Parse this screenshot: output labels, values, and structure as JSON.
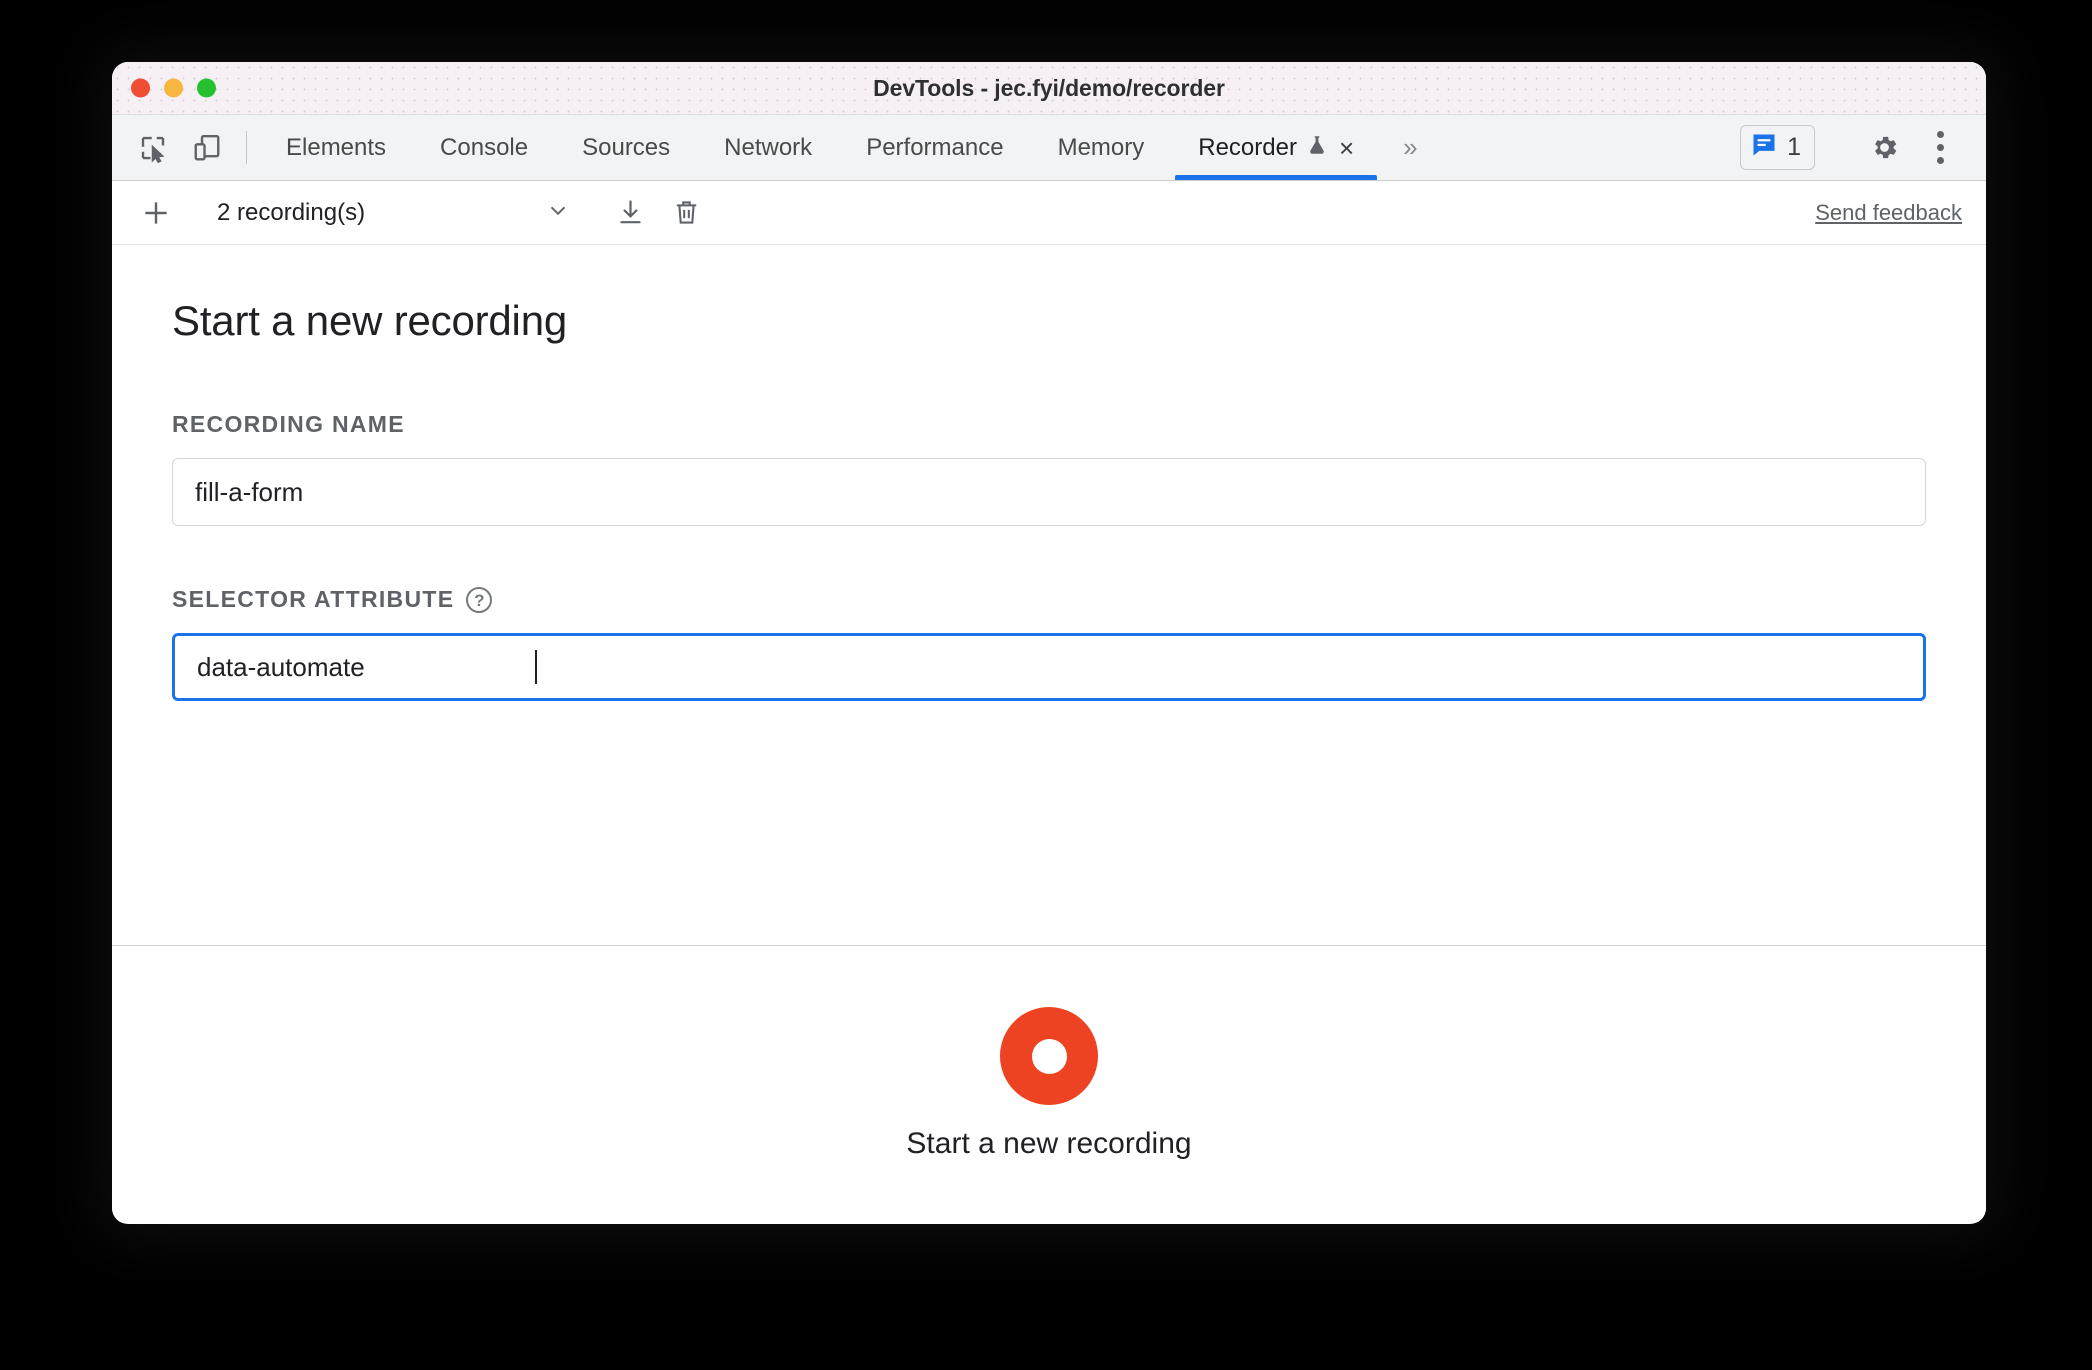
{
  "window": {
    "title": "DevTools - jec.fyi/demo/recorder",
    "traffic_lights": [
      "close",
      "minimize",
      "maximize"
    ]
  },
  "tabbar": {
    "left_icons": [
      {
        "name": "inspect-element-icon",
        "label": "Inspect element"
      },
      {
        "name": "device-toolbar-icon",
        "label": "Toggle device toolbar"
      }
    ],
    "tabs": [
      {
        "label": "Elements",
        "active": false
      },
      {
        "label": "Console",
        "active": false
      },
      {
        "label": "Sources",
        "active": false
      },
      {
        "label": "Network",
        "active": false
      },
      {
        "label": "Performance",
        "active": false
      },
      {
        "label": "Memory",
        "active": false
      },
      {
        "label": "Recorder",
        "active": true,
        "experimental": true,
        "closable": true
      }
    ],
    "tab_close_glyph": "×",
    "overflow_glyph": "»",
    "messages": {
      "count": "1",
      "icon": "message-bubble-icon"
    },
    "settings_icon": "gear-icon",
    "more_icon": "kebab-menu-icon",
    "active_underline_color": "#1a73e8"
  },
  "recorder_toolbar": {
    "add_glyph": "+",
    "recordings_label": "2 recording(s)",
    "dropdown_glyph": "⌄",
    "export_icon": "download-icon",
    "delete_icon": "trash-icon",
    "feedback_link": "Send feedback"
  },
  "main": {
    "heading": "Start a new recording",
    "fields": [
      {
        "label": "RECORDING NAME",
        "value": "fill-a-form",
        "placeholder": "Recording name",
        "focused": false,
        "help": false
      },
      {
        "label": "SELECTOR ATTRIBUTE",
        "value": "data-automate",
        "placeholder": "Selector attribute",
        "focused": true,
        "help": true,
        "help_glyph": "?"
      }
    ]
  },
  "footer": {
    "record_button_label": "Start a new recording",
    "record_button_color": "#ee4323",
    "record_button_name": "start-recording-button"
  }
}
